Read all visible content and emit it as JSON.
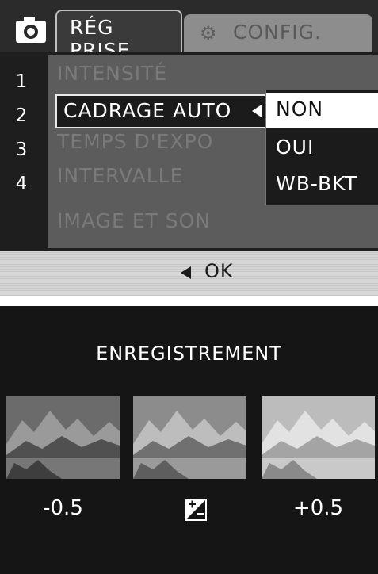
{
  "menu": {
    "tabs": [
      {
        "label": "RÉG PRISE",
        "icon": "camera-icon",
        "active": true
      },
      {
        "label": "CONFIG.",
        "icon": "wrench-icon",
        "active": false
      }
    ],
    "row_numbers": [
      "1",
      "2",
      "3",
      "4"
    ],
    "items": [
      {
        "label": "INTENSITÉ"
      },
      {
        "label": "CADRAGE AUTO",
        "selected": true
      },
      {
        "label": "TEMPS D'EXPO"
      },
      {
        "label": "INTERVALLE"
      },
      {
        "label": "IMAGE ET SON"
      }
    ],
    "options": [
      {
        "label": "NON",
        "selected": true
      },
      {
        "label": "OUI"
      },
      {
        "label": "WB-BKT"
      }
    ],
    "footer": {
      "label": "OK",
      "icon": "left-arrow-icon"
    }
  },
  "recording": {
    "title": "ENREGISTREMENT",
    "thumbnails": [
      {
        "label": "-0.5",
        "brightness": "dark"
      },
      {
        "label": "",
        "brightness": "normal",
        "icon": "exposure-compensation-icon"
      },
      {
        "label": "+0.5",
        "brightness": "bright"
      }
    ]
  },
  "colors": {
    "screen_bg": "#131313",
    "item_bg": "#5c5c5c",
    "footer_bg": "#cfcfcf",
    "highlight": "#ffffff"
  }
}
